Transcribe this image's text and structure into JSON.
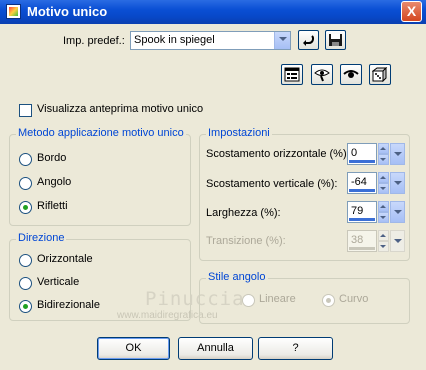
{
  "window": {
    "title": "Motivo unico",
    "close_glyph": "X"
  },
  "preset": {
    "label": "Imp. predef.:",
    "value": "Spook in spiegel"
  },
  "icons": {
    "reset": "reset-icon",
    "save": "save-icon",
    "dialog": "dialog-layout-icon",
    "preview_toggle": "preview-toggle-icon",
    "preview_eye": "eye-icon",
    "randomize": "dice-icon"
  },
  "preview_checkbox": {
    "label": "Visualizza anteprima motivo unico",
    "checked": false
  },
  "metodo": {
    "title": "Metodo applicazione motivo unico",
    "options": [
      {
        "label": "Bordo",
        "selected": false
      },
      {
        "label": "Angolo",
        "selected": false
      },
      {
        "label": "Rifletti",
        "selected": true
      }
    ]
  },
  "direzione": {
    "title": "Direzione",
    "options": [
      {
        "label": "Orizzontale",
        "selected": false
      },
      {
        "label": "Verticale",
        "selected": false
      },
      {
        "label": "Bidirezionale",
        "selected": true
      }
    ]
  },
  "impostazioni": {
    "title": "Impostazioni",
    "fields": [
      {
        "label": "Scostamento orizzontale (%):",
        "value": "0"
      },
      {
        "label": "Scostamento verticale (%):",
        "value": "-64"
      },
      {
        "label": "Larghezza (%):",
        "value": "79"
      },
      {
        "label": "Transizione (%):",
        "value": "38",
        "disabled": true
      }
    ]
  },
  "stile_angolo": {
    "title": "Stile angolo",
    "options": [
      {
        "label": "Lineare",
        "selected": false,
        "disabled": true
      },
      {
        "label": "Curvo",
        "selected": true,
        "disabled": true
      }
    ]
  },
  "watermark": {
    "line1": "Pinuccia",
    "line2": "www.maidiregrafica.eu"
  },
  "buttons": {
    "ok": "OK",
    "cancel": "Annulla",
    "help": "?"
  },
  "colors": {
    "titlebar": "#0a4fd4",
    "group_title": "#0046d5",
    "dialog_bg": "#ece9d8",
    "radio_dot": "#21a121"
  }
}
